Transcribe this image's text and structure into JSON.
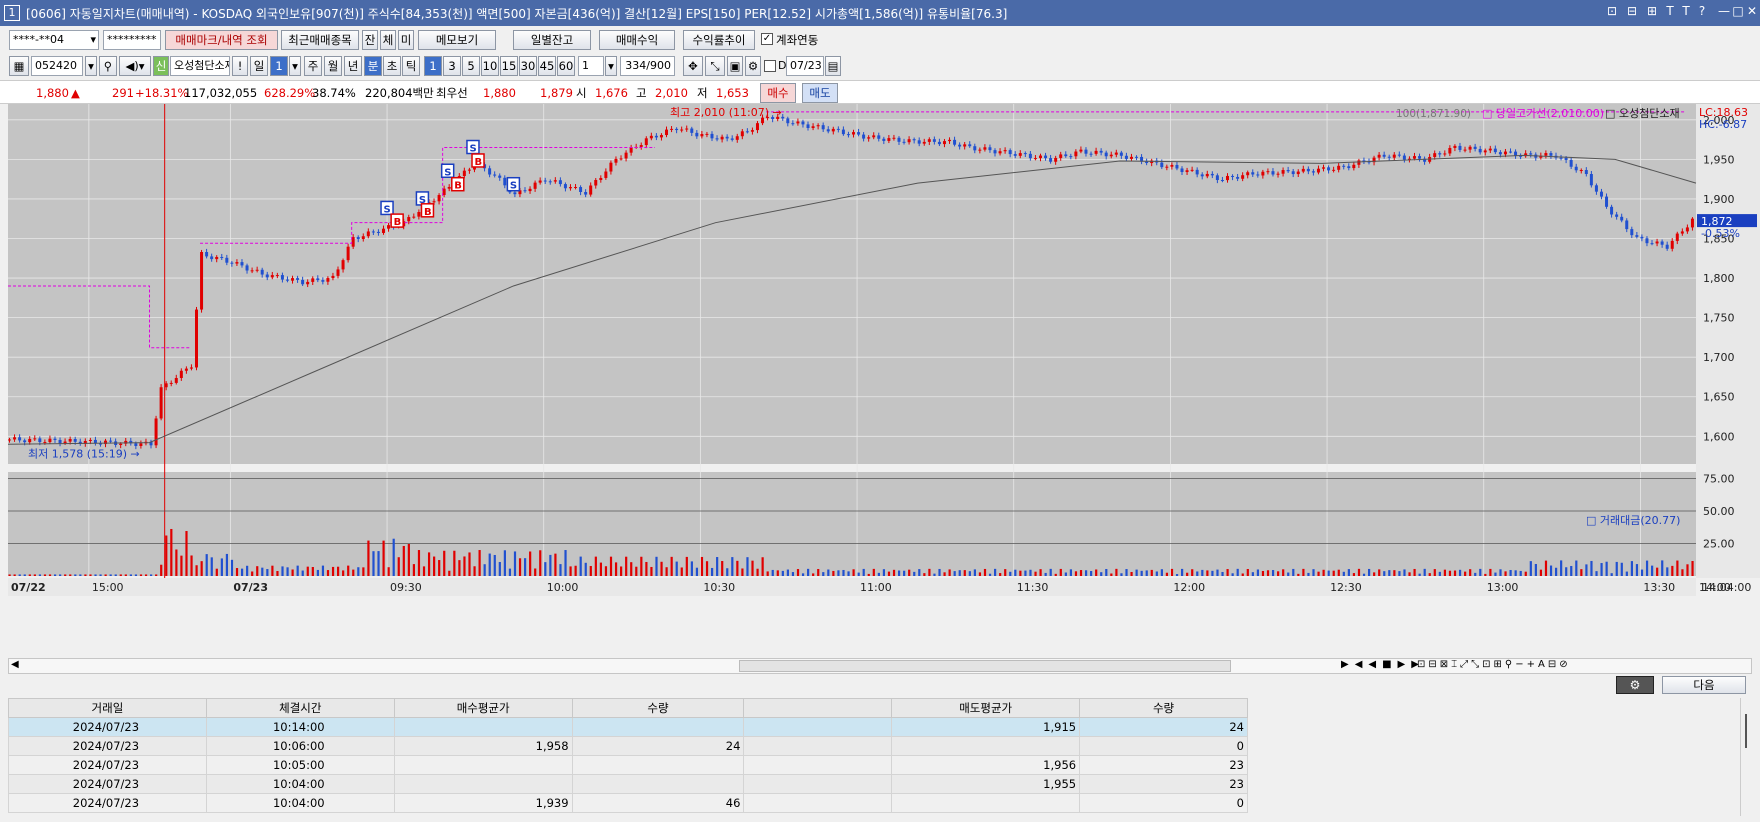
{
  "titlebar": {
    "num": "1",
    "text": "[0606] 자동일지차트(매매내역) - KOSDAQ 외국인보유[907(천)] 주식수[84,353(천)] 액면[500] 자본금[436(억)] 결산[12월] EPS[150] PER[12.52] 시가총액[1,586(억)] 유통비율[76.3]",
    "controls": [
      "⊡",
      "⊟",
      "⊞",
      "T",
      "T",
      "?",
      "—",
      "□",
      "✕"
    ]
  },
  "toolbar1": {
    "account": "****-**04",
    "password": "*********",
    "trade_mark_btn": "매매마크/내역 조회",
    "recent_btn": "최근매매종목",
    "tab_jan": "잔",
    "tab_che": "체",
    "tab_mi": "미",
    "memo_btn": "메모보기",
    "daily_btn": "일별잔고",
    "profit_btn": "매매수익",
    "rate_btn": "수익률추이",
    "account_link_label": "계좌연동"
  },
  "toolbar2": {
    "code": "052420",
    "stock_name": "오성첨단소재",
    "period_buttons": [
      "일",
      "1",
      "주",
      "월",
      "년",
      "분",
      "초",
      "틱"
    ],
    "minute_buttons": [
      "1",
      "3",
      "5",
      "10",
      "15",
      "30",
      "45",
      "60"
    ],
    "interval": "1",
    "count": "334/900",
    "date": "07/23",
    "d_label": "D"
  },
  "pricebar": {
    "price": "1,880",
    "arrow": "▲",
    "change": "291",
    "change_pct": "+18.31%",
    "volume": "117,032,055",
    "vol_ratio": "628.29%",
    "turnover": "38.74%",
    "amount": "220,804백만",
    "best_label": "최우선",
    "ask": "1,880",
    "bid": "1,879",
    "open_label": "시",
    "open": "1,676",
    "high_label": "고",
    "high": "2,010",
    "low_label": "저",
    "low": "1,653",
    "buy_btn": "매수",
    "sell_btn": "매도"
  },
  "chart_data": [
    {
      "type": "candlestick",
      "title": "",
      "x_labels": [
        "07/22",
        "15:00",
        "07/23",
        "09:30",
        "10:00",
        "10:30",
        "11:00",
        "11:30",
        "12:00",
        "12:30",
        "13:00",
        "13:30",
        "14:00",
        "14:04:00"
      ],
      "y_ticks": [
        "2,000",
        "1,950",
        "1,900",
        "1,850",
        "1,800",
        "1,750",
        "1,700",
        "1,650",
        "1,600"
      ],
      "ylim": [
        1565,
        2020
      ],
      "legend": {
        "ma": "100(1,871.90)",
        "prev_high": "당일고가선(2,010.00)",
        "name": "오성첨단소재"
      },
      "lc": "LC:18.63",
      "hc": "HC:-6.87",
      "current_price": "1,872",
      "current_change": "-0.53%",
      "annotations": {
        "high": "최고 2,010 (11:07)",
        "low": "최저 1,578 (15:19)"
      },
      "high_line": 2010,
      "series": {
        "close_path": [
          [
            0,
            1596
          ],
          [
            10,
            1594
          ],
          [
            20,
            1592
          ],
          [
            28,
            1590
          ],
          [
            30,
            1660
          ],
          [
            36,
            1690
          ],
          [
            38,
            1830
          ],
          [
            44,
            1820
          ],
          [
            50,
            1805
          ],
          [
            58,
            1795
          ],
          [
            64,
            1800
          ],
          [
            68,
            1850
          ],
          [
            74,
            1862
          ],
          [
            78,
            1870
          ],
          [
            82,
            1890
          ],
          [
            86,
            1910
          ],
          [
            92,
            1945
          ],
          [
            96,
            1930
          ],
          [
            100,
            1905
          ],
          [
            106,
            1925
          ],
          [
            114,
            1908
          ],
          [
            120,
            1950
          ],
          [
            126,
            1975
          ],
          [
            132,
            1990
          ],
          [
            136,
            1982
          ],
          [
            142,
            1975
          ],
          [
            146,
            1985
          ],
          [
            150,
            2005
          ],
          [
            156,
            1995
          ],
          [
            162,
            1988
          ],
          [
            170,
            1978
          ],
          [
            178,
            1973
          ],
          [
            186,
            1972
          ],
          [
            190,
            1965
          ],
          [
            198,
            1958
          ],
          [
            206,
            1950
          ],
          [
            212,
            1960
          ],
          [
            220,
            1955
          ],
          [
            230,
            1940
          ],
          [
            240,
            1925
          ],
          [
            246,
            1932
          ],
          [
            256,
            1935
          ],
          [
            264,
            1940
          ],
          [
            272,
            1955
          ],
          [
            280,
            1950
          ],
          [
            286,
            1965
          ],
          [
            294,
            1960
          ],
          [
            300,
            1955
          ],
          [
            306,
            1955
          ],
          [
            312,
            1930
          ],
          [
            316,
            1890
          ],
          [
            322,
            1850
          ],
          [
            328,
            1840
          ],
          [
            334,
            1880
          ]
        ],
        "ma_path": [
          [
            0,
            1590
          ],
          [
            28,
            1592
          ],
          [
            60,
            1680
          ],
          [
            100,
            1790
          ],
          [
            140,
            1870
          ],
          [
            180,
            1920
          ],
          [
            220,
            1948
          ],
          [
            260,
            1945
          ],
          [
            300,
            1955
          ],
          [
            318,
            1950
          ],
          [
            334,
            1920
          ]
        ]
      },
      "trade_marks": [
        {
          "t": 75,
          "type": "S",
          "p": 1888
        },
        {
          "t": 77,
          "type": "B",
          "p": 1872
        },
        {
          "t": 82,
          "type": "S",
          "p": 1900
        },
        {
          "t": 83,
          "type": "B",
          "p": 1885
        },
        {
          "t": 87,
          "type": "S",
          "p": 1935
        },
        {
          "t": 89,
          "type": "B",
          "p": 1918
        },
        {
          "t": 92,
          "type": "S",
          "p": 1965
        },
        {
          "t": 93,
          "type": "B",
          "p": 1948
        },
        {
          "t": 100,
          "type": "S",
          "p": 1918
        }
      ]
    },
    {
      "type": "bar",
      "title": "",
      "legend": "거래대금(20.77)",
      "y_ticks": [
        "75.00",
        "50.00",
        "25.00"
      ],
      "ylim": [
        0,
        80
      ]
    }
  ],
  "hscroll": {
    "next_btn": "다음"
  },
  "table": {
    "headers": [
      "거래일",
      "체결시간",
      "매수평균가",
      "수량",
      "",
      "매도평균가",
      "수량"
    ],
    "rows": [
      [
        "2024/07/23",
        "10:14:00",
        "",
        "",
        "",
        "1,915",
        "24"
      ],
      [
        "2024/07/23",
        "10:06:00",
        "1,958",
        "24",
        "",
        "",
        "0"
      ],
      [
        "2024/07/23",
        "10:05:00",
        "",
        "",
        "",
        "1,956",
        "23"
      ],
      [
        "2024/07/23",
        "10:04:00",
        "",
        "",
        "",
        "1,955",
        "23"
      ],
      [
        "2024/07/23",
        "10:04:00",
        "1,939",
        "46",
        "",
        "",
        "0"
      ]
    ]
  },
  "colors": {
    "up": "#e00000",
    "down": "#2050d0",
    "ma": "#555555",
    "high_line": "#e000e0",
    "chart_bg": "#c4c4c4",
    "title_bg": "#4a6aa8"
  }
}
